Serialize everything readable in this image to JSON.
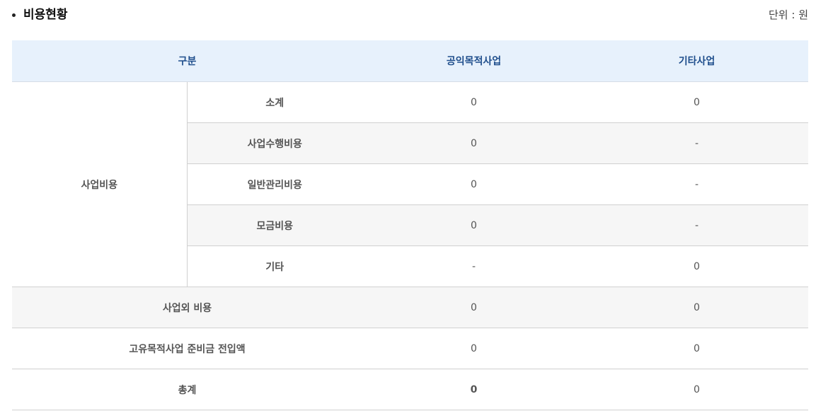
{
  "section": {
    "title": "비용현황",
    "unit": "단위 : 원"
  },
  "table": {
    "headers": {
      "category": "구분",
      "public_purpose": "공익목적사업",
      "other": "기타사업"
    },
    "group_label": "사업비용",
    "sub_rows": [
      {
        "label": "소계",
        "public_purpose": "0",
        "other": "0"
      },
      {
        "label": "사업수행비용",
        "public_purpose": "0",
        "other": "-"
      },
      {
        "label": "일반관리비용",
        "public_purpose": "0",
        "other": "-"
      },
      {
        "label": "모금비용",
        "public_purpose": "0",
        "other": "-"
      },
      {
        "label": "기타",
        "public_purpose": "-",
        "other": "0"
      }
    ],
    "rows": [
      {
        "label": "사업외 비용",
        "public_purpose": "0",
        "other": "0"
      },
      {
        "label": "고유목적사업 준비금 전입액",
        "public_purpose": "0",
        "other": "0"
      },
      {
        "label": "총계",
        "public_purpose": "0",
        "other": "0"
      }
    ]
  }
}
